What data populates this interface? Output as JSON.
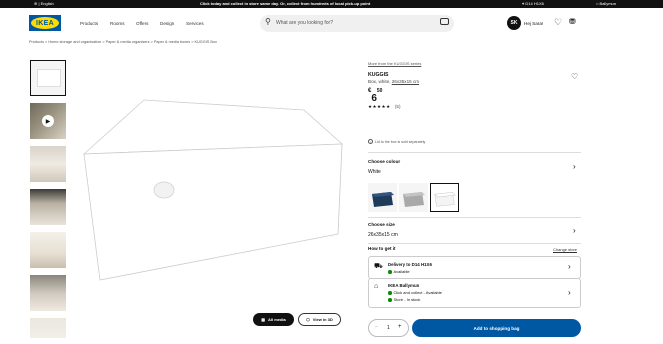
{
  "topbar": {
    "language": "English",
    "promo": "Click today and collect in store same day. Or, collect from hundreds of local pick-up point",
    "postcode": "D14 H1X6",
    "store": "Ballymun"
  },
  "header": {
    "logo": "IKEA",
    "nav": [
      "Products",
      "Rooms",
      "Offers",
      "Design",
      "Services"
    ],
    "search_placeholder": "What are you looking for?",
    "avatar_initials": "SK",
    "greeting": "Hej Sara!"
  },
  "breadcrumb": [
    "Products",
    "Home storage and organisation",
    "Paper & media organisers",
    "Paper & media boxes",
    "KUGGIS Box"
  ],
  "gallery": {
    "all_media_label": "All media",
    "view_label": "View in 3D"
  },
  "product": {
    "series_link": "More from the KUGGIS series",
    "name": "KUGGIS",
    "description": "Box, white, ",
    "size_link": "26x35x15 cm",
    "currency": "€",
    "price_whole": "6",
    "price_decimal": "50",
    "rating": 5,
    "rating_stars": "★★★★★",
    "review_count": "(5)",
    "lid_note": "Lid to the box is sold separately"
  },
  "colour": {
    "label": "Choose colour",
    "selected": "White",
    "swatches": [
      {
        "name": "dark-blue",
        "color": "#1f3b5c"
      },
      {
        "name": "grey",
        "color": "#a9a9a9"
      },
      {
        "name": "white",
        "color": "#f4f4f4"
      }
    ]
  },
  "size": {
    "label": "Choose size",
    "selected": "26x35x15 cm"
  },
  "get_it": {
    "label": "How to get it",
    "change_store": "Change store",
    "delivery_title": "Delivery to D14 H1X6",
    "delivery_status": "Available",
    "store_title": "IKEA Ballymun",
    "store_line1": "Click and collect - Available",
    "store_line2": "Store - In stock"
  },
  "purchase": {
    "quantity": "1",
    "minus": "−",
    "plus": "+",
    "add_label": "Add to shopping bag"
  },
  "colors": {
    "ikea_blue": "#0058a3",
    "ikea_yellow": "#ffdb00",
    "available_green": "#0a8a00"
  }
}
